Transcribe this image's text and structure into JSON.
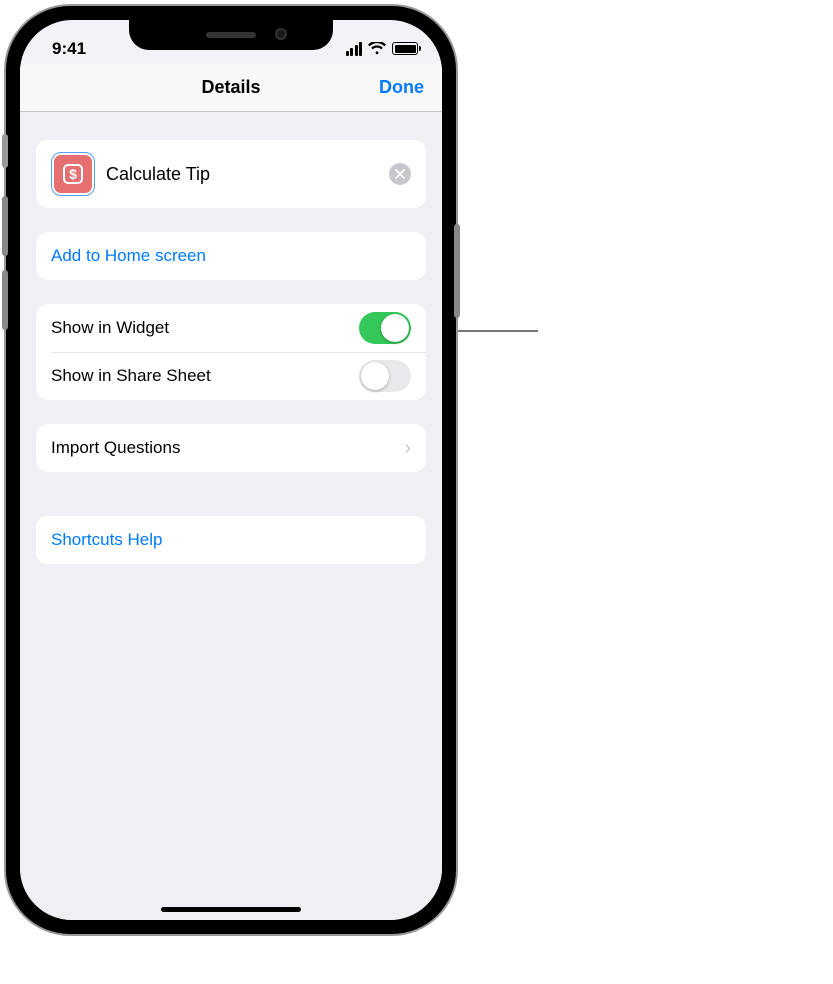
{
  "statusbar": {
    "time": "9:41"
  },
  "navbar": {
    "title": "Details",
    "done": "Done"
  },
  "shortcut": {
    "name": "Calculate Tip",
    "icon_name": "dollar-sign-icon"
  },
  "actions": {
    "add_home": "Add to Home screen",
    "show_widget_label": "Show in Widget",
    "show_widget_on": true,
    "show_share_label": "Show in Share Sheet",
    "show_share_on": false,
    "import_questions": "Import Questions",
    "help": "Shortcuts Help"
  }
}
